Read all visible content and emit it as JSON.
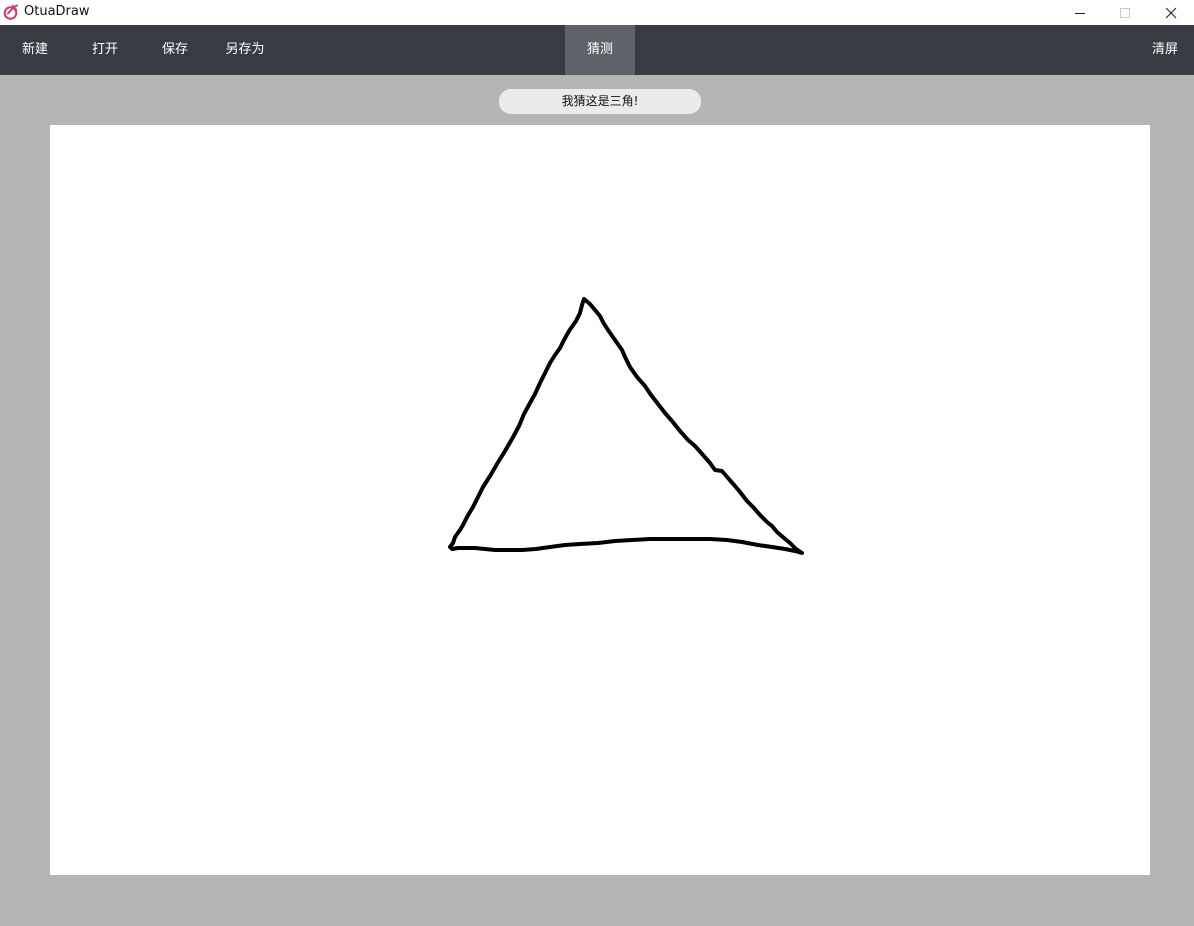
{
  "window": {
    "title": "OtuaDraw",
    "logo_icon": "otuadraw-logo-icon",
    "controls": [
      "minimize-icon",
      "maximize-icon",
      "close-icon"
    ]
  },
  "menu": {
    "new_label": "新建",
    "open_label": "打开",
    "save_label": "保存",
    "save_as_label": "另存为",
    "guess_label": "猜测",
    "clear_label": "清屏"
  },
  "guess_result": "我猜这是三角!",
  "canvas": {
    "stroke_color": "#000000",
    "drawing": "hand-drawn-triangle"
  },
  "colors": {
    "menubar": "#393b43",
    "menu_active": "#60626a",
    "workspace": "#b4b5b4",
    "logo": "#d4376e"
  }
}
